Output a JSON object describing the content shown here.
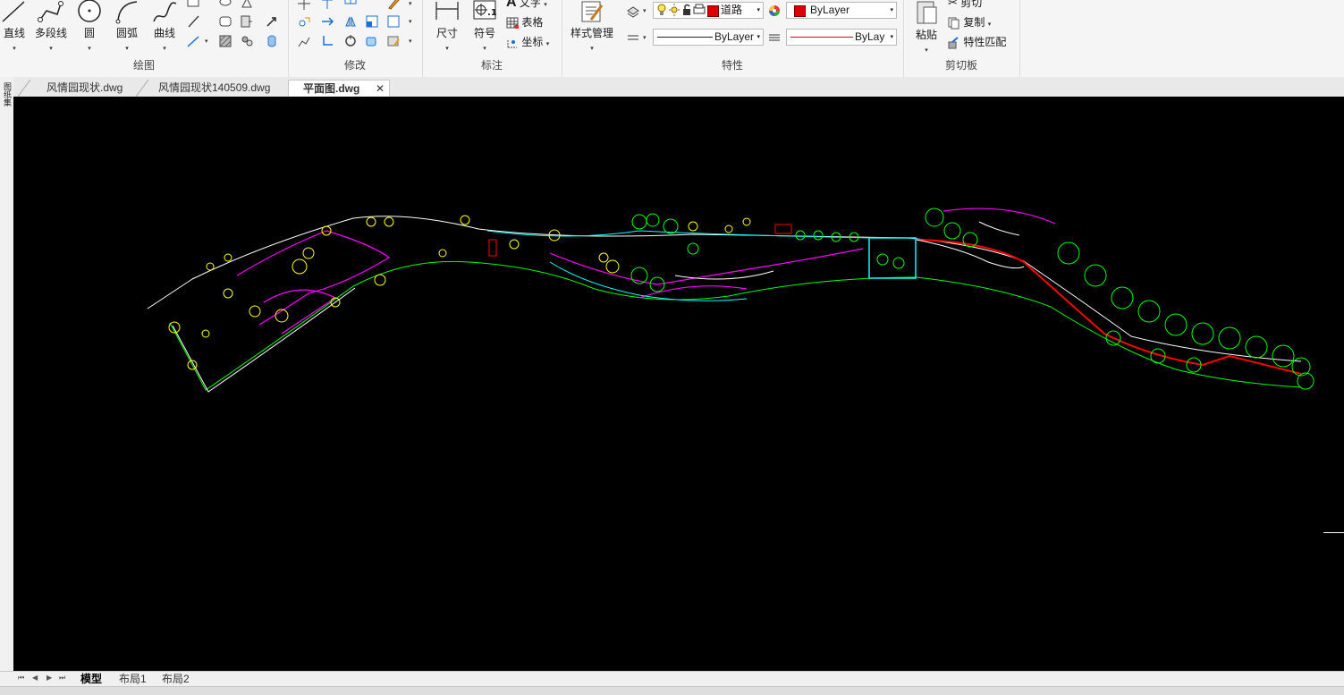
{
  "ribbon": {
    "draw": {
      "label": "绘图",
      "buttons": [
        "直线",
        "多段线",
        "圆",
        "圆弧",
        "曲线"
      ]
    },
    "modify": {
      "label": "修改"
    },
    "annotation": {
      "label": "标注",
      "dimension": "尺寸",
      "symbol": "符号",
      "text": "文字",
      "table": "表格",
      "coordinate": "坐标"
    },
    "properties": {
      "label": "特性",
      "style_manager": "样式管理",
      "layer_name": "道路",
      "color_value": "ByLayer",
      "linetype_value": "ByLayer",
      "lineweight_value": "ByLayer",
      "color_swatch": "#e00000"
    },
    "clipboard": {
      "label": "剪切板",
      "paste": "粘贴",
      "cut": "剪切",
      "copy": "复制",
      "match": "特性匹配"
    }
  },
  "file_tabs": [
    {
      "label": "风情园现状.dwg"
    },
    {
      "label": "风情园现状140509.dwg"
    },
    {
      "label": "平面图.dwg",
      "active": true
    }
  ],
  "sidebar": {
    "label": "图纸集"
  },
  "layout_tabs": [
    {
      "label": "模型",
      "active": true
    },
    {
      "label": "布局1"
    },
    {
      "label": "布局2"
    }
  ],
  "colors": {
    "canvas": "#000000",
    "cad_yellow": "#ffff00",
    "cad_green": "#00ff00",
    "cad_magenta": "#ff00ff",
    "cad_cyan": "#00ffff",
    "cad_red": "#ff0000",
    "cad_white": "#ffffff"
  }
}
